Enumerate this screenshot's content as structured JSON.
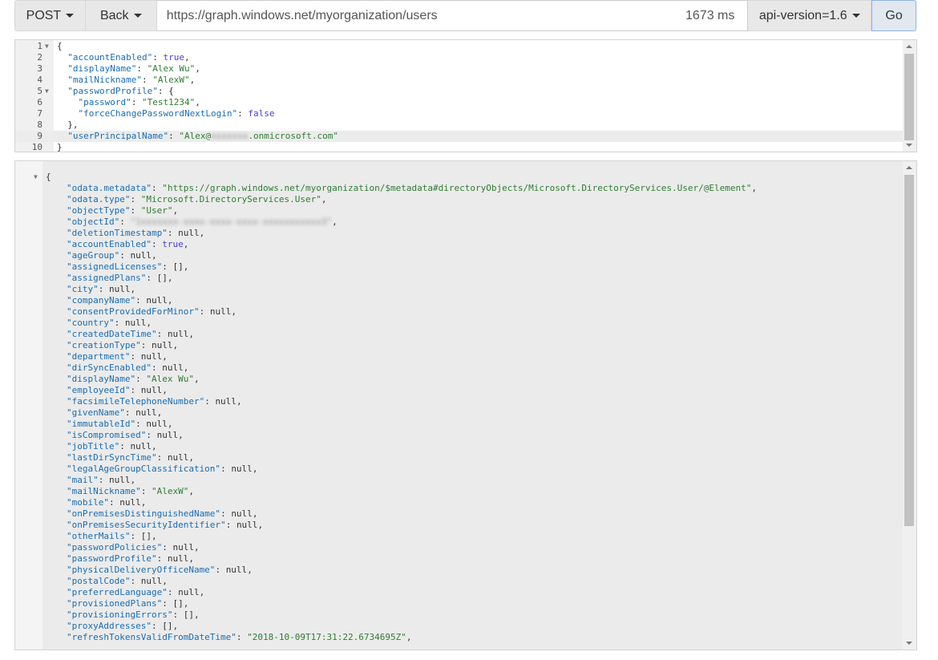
{
  "toolbar": {
    "method_label": "POST",
    "back_label": "Back",
    "url_value": "https://graph.windows.net/myorganization/users",
    "timing": "1673 ms",
    "api_version_label": "api-version=1.6",
    "go_label": "Go"
  },
  "request": {
    "line_numbers": [
      "1",
      "2",
      "3",
      "4",
      "5",
      "6",
      "7",
      "8",
      "9",
      "10"
    ],
    "lines": [
      {
        "k": "{",
        "p": "",
        "v": "",
        "c": ""
      },
      {
        "k": "  \"accountEnabled\"",
        "p": ": ",
        "v": "true",
        "c": ","
      },
      {
        "k": "  \"displayName\"",
        "p": ": ",
        "v": "\"Alex Wu\"",
        "c": ","
      },
      {
        "k": "  \"mailNickname\"",
        "p": ": ",
        "v": "\"AlexW\"",
        "c": ","
      },
      {
        "k": "  \"passwordProfile\"",
        "p": ": {",
        "v": "",
        "c": ""
      },
      {
        "k": "    \"password\"",
        "p": ": ",
        "v": "\"Test1234\"",
        "c": ","
      },
      {
        "k": "    \"forceChangePasswordNextLogin\"",
        "p": ": ",
        "v": "false",
        "c": ""
      },
      {
        "k": "  },",
        "p": "",
        "v": "",
        "c": ""
      },
      {
        "k": "  \"userPrincipalName\"",
        "p": ": ",
        "v": "\"Alex@",
        "c": ""
      },
      {
        "k": "}",
        "p": "",
        "v": "",
        "c": ""
      }
    ],
    "upn_redacted": "xxxxxxx",
    "upn_suffix": ".onmicrosoft.com\""
  },
  "response": {
    "open_brace": "{",
    "lines": [
      {
        "k": "\"odata.metadata\"",
        "v": "\"https://graph.windows.net/myorganization/$metadata#directoryObjects/Microsoft.DirectoryServices.User/@Element\""
      },
      {
        "k": "\"odata.type\"",
        "v": "\"Microsoft.DirectoryServices.User\""
      },
      {
        "k": "\"objectType\"",
        "v": "\"User\""
      },
      {
        "k": "\"objectId\"",
        "v": "\"1xxxxxxx-xxxx-xxxx-xxxx-xxxxxxxxxxx3\"",
        "redacted": true
      },
      {
        "k": "\"deletionTimestamp\"",
        "v": "null"
      },
      {
        "k": "\"accountEnabled\"",
        "v": "true",
        "kw": true
      },
      {
        "k": "\"ageGroup\"",
        "v": "null"
      },
      {
        "k": "\"assignedLicenses\"",
        "v": "[]"
      },
      {
        "k": "\"assignedPlans\"",
        "v": "[]"
      },
      {
        "k": "\"city\"",
        "v": "null"
      },
      {
        "k": "\"companyName\"",
        "v": "null"
      },
      {
        "k": "\"consentProvidedForMinor\"",
        "v": "null"
      },
      {
        "k": "\"country\"",
        "v": "null"
      },
      {
        "k": "\"createdDateTime\"",
        "v": "null"
      },
      {
        "k": "\"creationType\"",
        "v": "null"
      },
      {
        "k": "\"department\"",
        "v": "null"
      },
      {
        "k": "\"dirSyncEnabled\"",
        "v": "null"
      },
      {
        "k": "\"displayName\"",
        "v": "\"Alex Wu\""
      },
      {
        "k": "\"employeeId\"",
        "v": "null"
      },
      {
        "k": "\"facsimileTelephoneNumber\"",
        "v": "null"
      },
      {
        "k": "\"givenName\"",
        "v": "null"
      },
      {
        "k": "\"immutableId\"",
        "v": "null"
      },
      {
        "k": "\"isCompromised\"",
        "v": "null"
      },
      {
        "k": "\"jobTitle\"",
        "v": "null"
      },
      {
        "k": "\"lastDirSyncTime\"",
        "v": "null"
      },
      {
        "k": "\"legalAgeGroupClassification\"",
        "v": "null"
      },
      {
        "k": "\"mail\"",
        "v": "null"
      },
      {
        "k": "\"mailNickname\"",
        "v": "\"AlexW\""
      },
      {
        "k": "\"mobile\"",
        "v": "null"
      },
      {
        "k": "\"onPremisesDistinguishedName\"",
        "v": "null"
      },
      {
        "k": "\"onPremisesSecurityIdentifier\"",
        "v": "null"
      },
      {
        "k": "\"otherMails\"",
        "v": "[]"
      },
      {
        "k": "\"passwordPolicies\"",
        "v": "null"
      },
      {
        "k": "\"passwordProfile\"",
        "v": "null"
      },
      {
        "k": "\"physicalDeliveryOfficeName\"",
        "v": "null"
      },
      {
        "k": "\"postalCode\"",
        "v": "null"
      },
      {
        "k": "\"preferredLanguage\"",
        "v": "null"
      },
      {
        "k": "\"provisionedPlans\"",
        "v": "[]"
      },
      {
        "k": "\"provisioningErrors\"",
        "v": "[]"
      },
      {
        "k": "\"proxyAddresses\"",
        "v": "[]"
      },
      {
        "k": "\"refreshTokensValidFromDateTime\"",
        "v": "\"2018-10-09T17:31:22.6734695Z\""
      }
    ]
  }
}
